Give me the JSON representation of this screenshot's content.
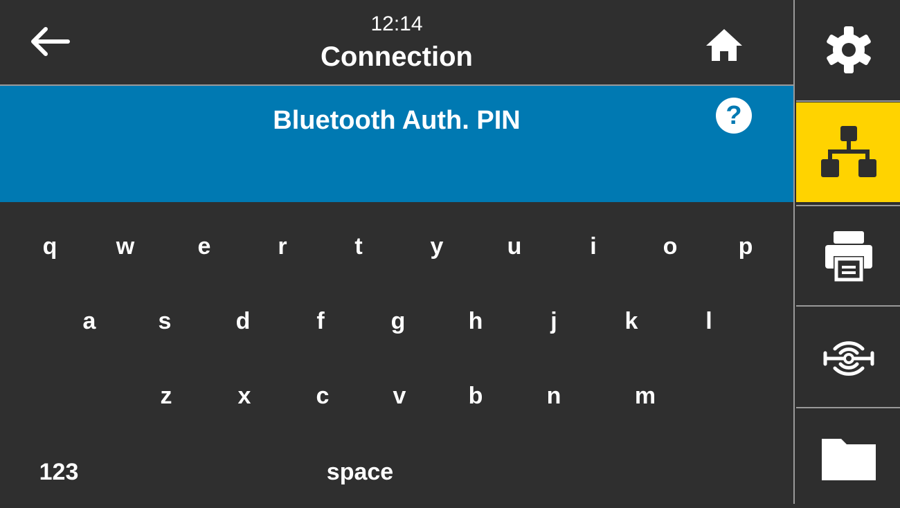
{
  "header": {
    "time": "12:14",
    "title": "Connection"
  },
  "banner": {
    "title": "Bluetooth Auth. PIN",
    "help_label": "?"
  },
  "keyboard": {
    "row1": [
      "q",
      "w",
      "e",
      "r",
      "t",
      "y",
      "u",
      "i",
      "o",
      "p"
    ],
    "row2": [
      "a",
      "s",
      "d",
      "f",
      "g",
      "h",
      "j",
      "k",
      "l"
    ],
    "row3": [
      "z",
      "x",
      "c",
      "v",
      "b",
      "n",
      "m"
    ],
    "mode_key": "123",
    "space_key": "space"
  },
  "nav": {
    "items": [
      "settings-icon",
      "network-icon",
      "printer-icon",
      "sensor-icon",
      "folder-icon"
    ],
    "active": "network-icon"
  },
  "colors": {
    "background": "#2f2f2f",
    "banner": "#0079b2",
    "active": "#ffd300",
    "text": "#ffffff"
  }
}
